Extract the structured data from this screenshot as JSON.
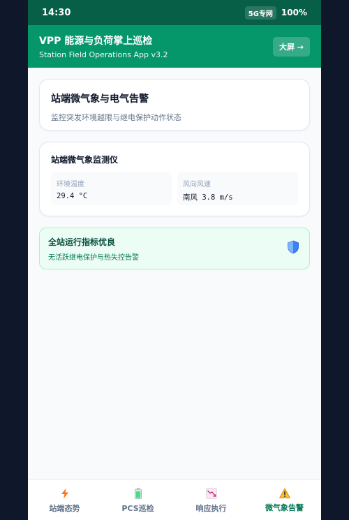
{
  "status_bar": {
    "time": "14:30",
    "network": "5G专网",
    "battery": "100%"
  },
  "header": {
    "title": "VPP 能源与负荷掌上巡检",
    "subtitle": "Station Field Operations App v3.2",
    "big_screen_label": "大屏 →"
  },
  "hero": {
    "title": "站端微气象与电气告警",
    "subtitle": "监控突发环境越限与继电保护动作状态"
  },
  "weather_monitor": {
    "title": "站端微气象监测仪",
    "tiles": [
      {
        "label": "环境温度",
        "value": "29.4 °C"
      },
      {
        "label": "风向风速",
        "value": "南风 3.8 m/s"
      }
    ]
  },
  "status_banner": {
    "title": "全站运行指标优良",
    "subtitle": "无活跃继电保护与热失控告警",
    "icon": "shield-icon"
  },
  "tabs": [
    {
      "label": "站端态势",
      "icon": "lightning-icon",
      "active": false
    },
    {
      "label": "PCS巡检",
      "icon": "battery-icon",
      "active": false
    },
    {
      "label": "响应执行",
      "icon": "chart-down-icon",
      "active": false
    },
    {
      "label": "微气象告警",
      "icon": "warning-icon",
      "active": true
    }
  ],
  "colors": {
    "status_bar_bg": "#065f46",
    "header_bg": "#059669",
    "page_bg": "#f8fafc",
    "outer_bg": "#0f172a",
    "ok_banner_bg": "#ecfdf5",
    "active_tab": "#047857"
  }
}
